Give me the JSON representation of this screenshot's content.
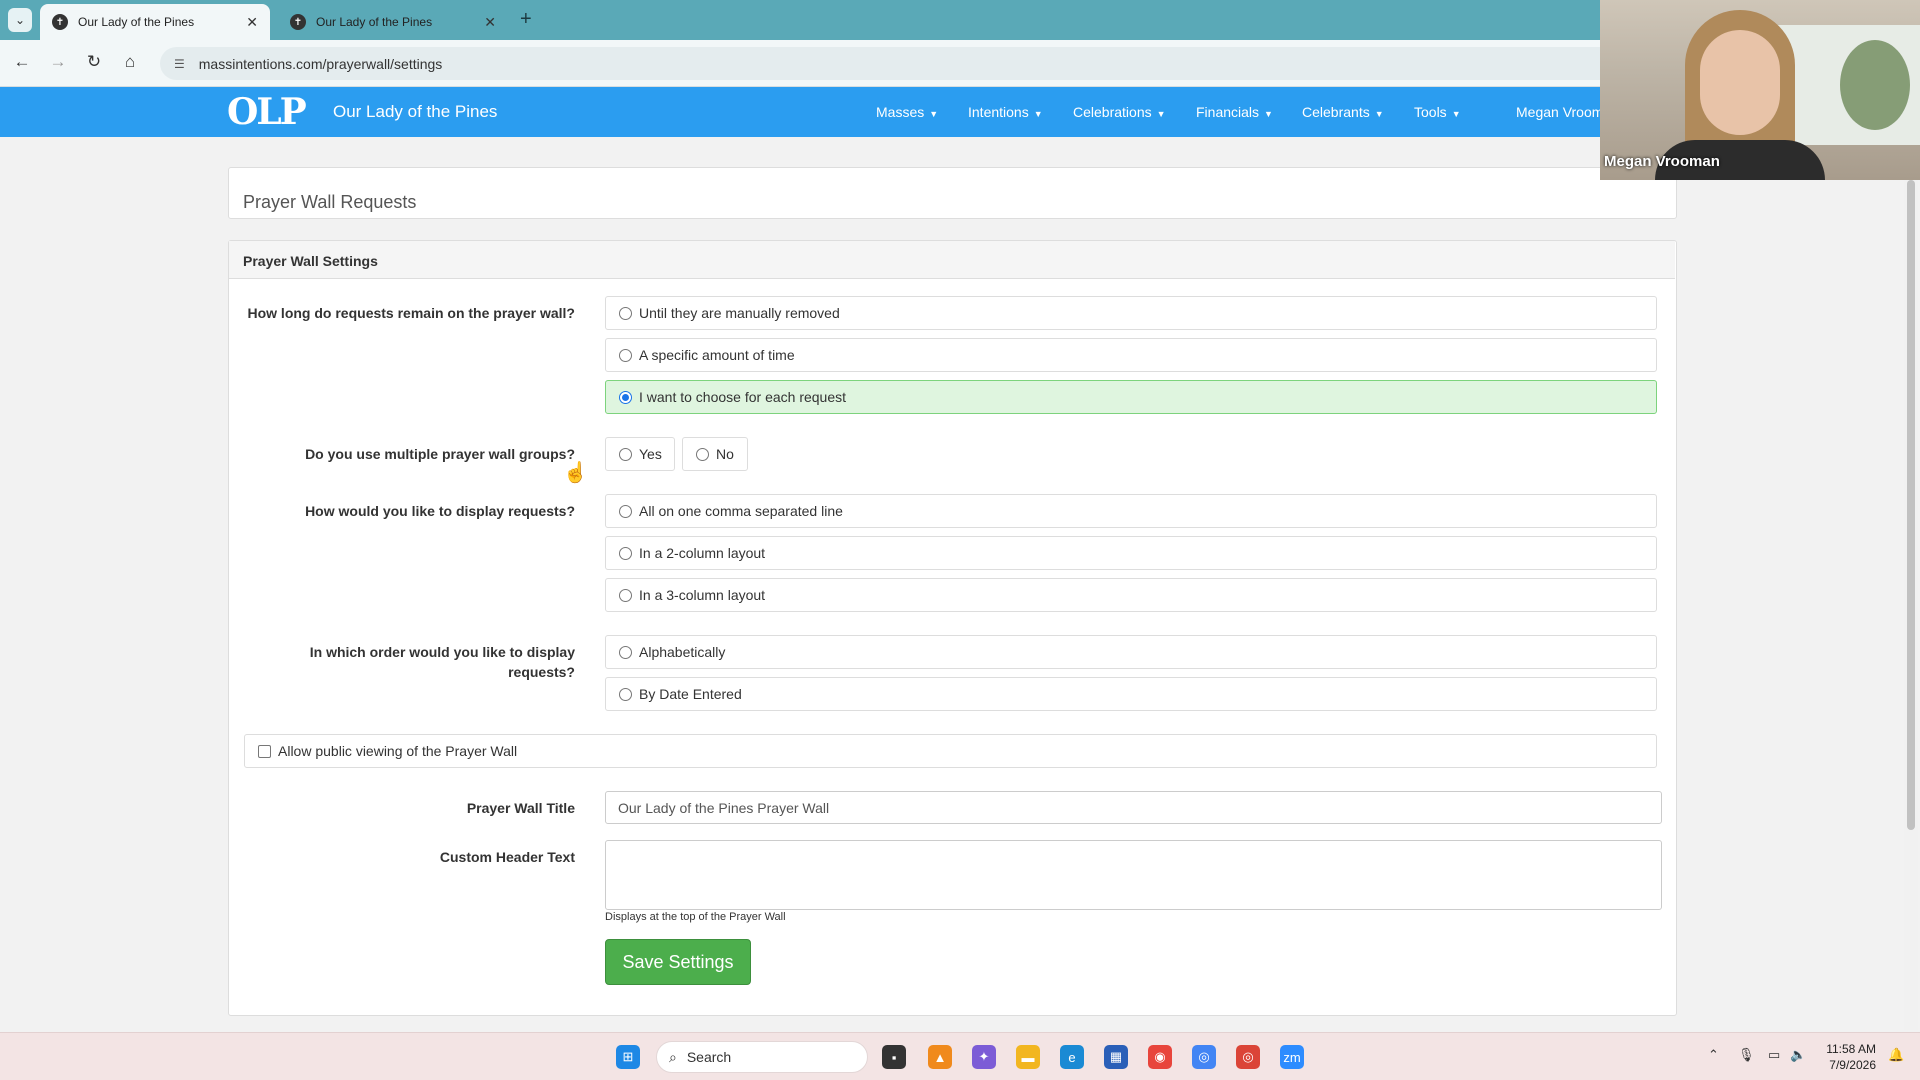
{
  "browser": {
    "tabs": [
      {
        "title": "Our Lady of the Pines",
        "active": true
      },
      {
        "title": "Our Lady of the Pines",
        "active": false
      }
    ],
    "url": "massintentions.com/prayerwall/settings"
  },
  "nav": {
    "logo": "OLP",
    "brand": "Our Lady of the Pines",
    "menus": [
      "Masses",
      "Intentions",
      "Celebrations",
      "Financials",
      "Celebrants",
      "Tools"
    ],
    "user": "Megan Vroom"
  },
  "page": {
    "title": "Prayer Wall Requests",
    "section_title": "Prayer Wall Settings"
  },
  "form": {
    "q_duration": "How long do requests remain on the prayer wall?",
    "duration_options": [
      "Until they are manually removed",
      "A specific amount of time",
      "I want to choose for each request"
    ],
    "q_groups": "Do you use multiple prayer wall groups?",
    "groups_options": [
      "Yes",
      "No"
    ],
    "q_display": "How would you like to display requests?",
    "display_options": [
      "All on one comma separated line",
      "In a 2-column layout",
      "In a 3-column layout"
    ],
    "q_order": "In which order would you like to display requests?",
    "order_options": [
      "Alphabetically",
      "By Date Entered"
    ],
    "public_label": "Allow public viewing of the Prayer Wall",
    "title_label": "Prayer Wall Title",
    "title_value": "Our Lady of the Pines Prayer Wall",
    "header_label": "Custom Header Text",
    "header_help": "Displays at the top of the Prayer Wall",
    "save_label": "Save Settings"
  },
  "webcam": {
    "name": "Megan Vrooman"
  },
  "taskbar": {
    "search_label": "Search",
    "time": "11:58 AM",
    "date": "7/9/2026"
  }
}
